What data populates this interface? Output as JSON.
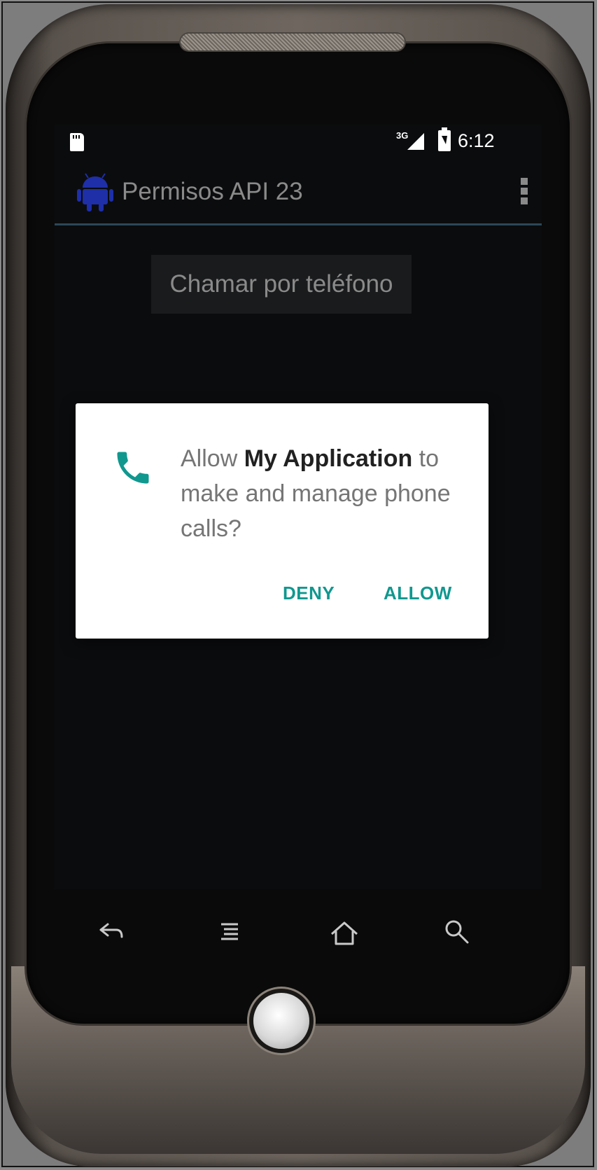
{
  "status_bar": {
    "network": "3G",
    "time": "6:12"
  },
  "app_bar": {
    "title": "Permisos API 23"
  },
  "main": {
    "call_button_label": "Chamar por teléfono"
  },
  "dialog": {
    "prefix": "Allow ",
    "app_name": "My Application",
    "message": " to make and manage phone calls?",
    "deny_label": "DENY",
    "allow_label": "ALLOW",
    "accent_color": "#10988f"
  },
  "softkeys": [
    "back-icon",
    "menu-icon",
    "home-icon",
    "search-icon"
  ]
}
